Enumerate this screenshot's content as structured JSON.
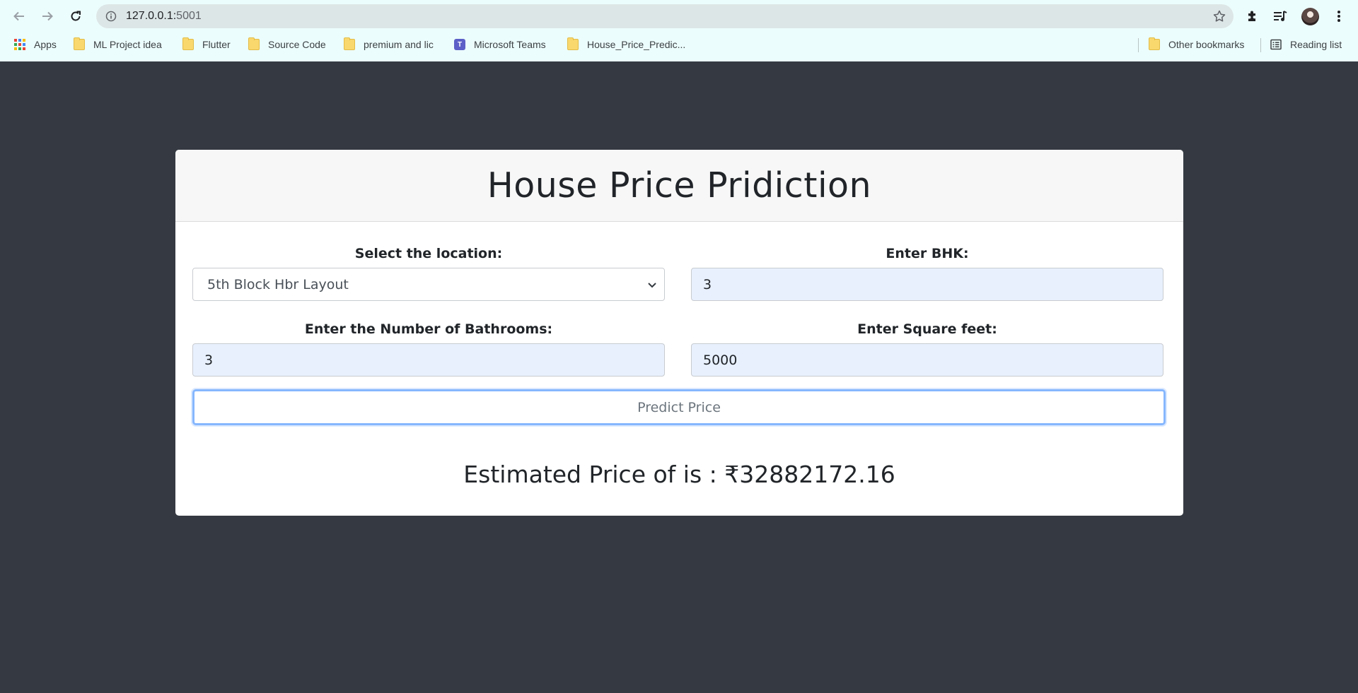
{
  "browser": {
    "url_host": "127.0.0.1:",
    "url_port": "5001",
    "bookmarks": [
      {
        "label": "Apps"
      },
      {
        "label": "ML Project idea"
      },
      {
        "label": "Flutter"
      },
      {
        "label": "Source Code"
      },
      {
        "label": "premium and lic"
      },
      {
        "label": "Microsoft Teams"
      },
      {
        "label": "House_Price_Predic..."
      }
    ],
    "other_bookmarks": "Other bookmarks",
    "reading_list": "Reading list"
  },
  "page": {
    "title": "House Price Pridiction",
    "location": {
      "label": "Select the location:",
      "selected": "5th Block Hbr Layout"
    },
    "bhk": {
      "label": "Enter BHK:",
      "value": "3"
    },
    "bathrooms": {
      "label": "Enter the Number of Bathrooms:",
      "value": "3"
    },
    "sqft": {
      "label": "Enter Square feet:",
      "value": "5000"
    },
    "predict_button": "Predict Price",
    "result": "Estimated Price of is : ₹32882172.16"
  },
  "colors": {
    "page_background": "#353a42",
    "chrome_background": "#ecfdfd",
    "input_fill": "#e8f0fe",
    "focus_ring": "#86b7fe"
  }
}
